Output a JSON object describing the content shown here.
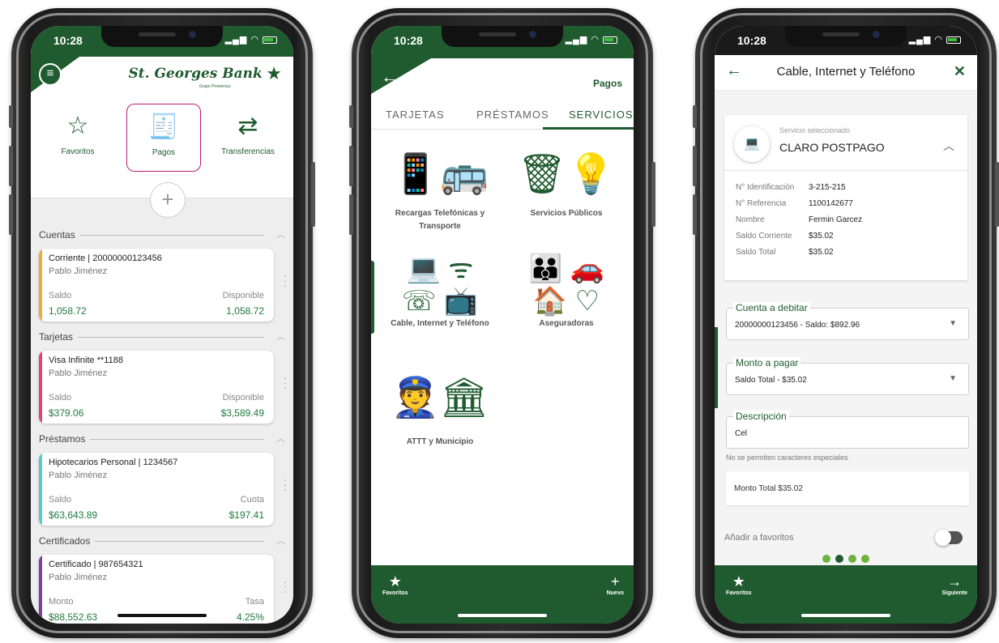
{
  "status": {
    "time": "10:28"
  },
  "phone1": {
    "brand": {
      "name": "St. Georges Bank",
      "tagline": "Grupo Promerica"
    },
    "quick_actions": [
      {
        "label": "Favoritos",
        "icon": "star-icon"
      },
      {
        "label": "Pagos",
        "icon": "bill-icon"
      },
      {
        "label": "Transferencias",
        "icon": "transfer-icon"
      }
    ],
    "sections": [
      {
        "title": "Cuentas",
        "card": {
          "title": "Corriente | 20000000123456",
          "owner": "Pablo Jiménez",
          "left_label": "Saldo",
          "left_value": "1,058.72",
          "right_label": "Disponible",
          "right_value": "1,058.72",
          "color": "#f2a93b"
        }
      },
      {
        "title": "Tarjetas",
        "card": {
          "title": "Visa Infinite  **1188",
          "owner": "Pablo Jiménez",
          "left_label": "Saldo",
          "left_value": "$379.06",
          "right_label": "Disponible",
          "right_value": "$3,589.49",
          "color": "#e0456f"
        }
      },
      {
        "title": "Préstamos",
        "card": {
          "title": "Hipotecarios Personal | 1234567",
          "owner": "Pablo Jiménez",
          "left_label": "Saldo",
          "left_value": "$63,643.89",
          "right_label": "Cuota",
          "right_value": "$197.41",
          "color": "#5cc9c9"
        }
      },
      {
        "title": "Certificados",
        "card": {
          "title": "Certificado | 987654321",
          "owner": "Pablo Jiménez",
          "left_label": "Monto",
          "left_value": "$88,552.63",
          "right_label": "Tasa",
          "right_value": "4.25%",
          "color": "#7b3fa0"
        }
      }
    ]
  },
  "phone2": {
    "title": "Pagos",
    "tabs": [
      "TARJETAS",
      "PRÉSTAMOS",
      "SERVICIOS"
    ],
    "services": [
      {
        "label": "Recargas Telefónicas y Transporte",
        "icon": "phone-bus-icon"
      },
      {
        "label": "Servicios Públicos",
        "icon": "utilities-icon"
      },
      {
        "label": "Cable, Internet y Teléfono",
        "icon": "cable-internet-icon"
      },
      {
        "label": "Aseguradoras",
        "icon": "insurance-icon"
      },
      {
        "label": "ATTT y Municipio",
        "icon": "municipal-icon"
      }
    ],
    "bottom": {
      "left": "Favoritos",
      "right": "Nuevo"
    }
  },
  "phone3": {
    "title": "Cable, Internet y Teléfono",
    "service_caption": "Servicio seleccionado",
    "service_name": "CLARO POSTPAGO",
    "details": [
      {
        "key": "N° Identificación",
        "value": "3-215-215"
      },
      {
        "key": "N° Referencia",
        "value": "1100142677"
      },
      {
        "key": "Nombre",
        "value": "Fermin Garcez"
      },
      {
        "key": "Saldo Corriente",
        "value": "$35.02"
      },
      {
        "key": "Saldo Total",
        "value": "$35.02"
      }
    ],
    "account_label": "Cuenta a debitar",
    "account_value": "20000000123456 - Saldo: $892.96",
    "amount_label": "Monto a pagar",
    "amount_value": "Saldo Total - $35.02",
    "desc_label": "Descripción",
    "desc_value": "Cel",
    "hint": "No se permiten caracteres especiales",
    "total": "Monto Total $35.02",
    "fav_label": "Añadir a favoritos",
    "bottom": {
      "left": "Favoritos",
      "right": "Siguiente"
    }
  },
  "colors": {
    "brand_green": "#1f5b2f",
    "accent_green": "#6cb33f",
    "selected_border": "#c0197a"
  }
}
